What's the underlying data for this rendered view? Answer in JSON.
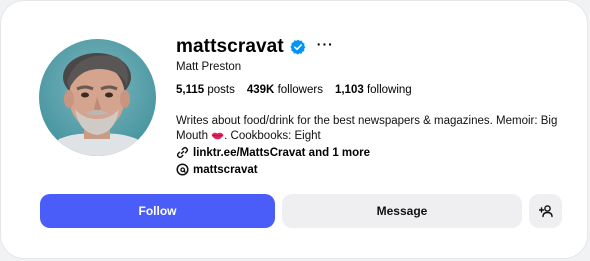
{
  "profile": {
    "username": "mattscravat",
    "full_name": "Matt Preston",
    "verified_icon": "verified-badge-icon",
    "more_icon": "more-options-icon",
    "more_glyph": "···",
    "stats": {
      "posts_count": "5,115",
      "posts_label": "posts",
      "followers_count": "439K",
      "followers_label": "followers",
      "following_count": "1,103",
      "following_label": "following"
    },
    "bio_line1": "Writes about food/drink for the best newspapers & magazines. Memoir: Big",
    "bio_line2_start": "Mouth",
    "bio_lips_emoji": "lips-emoji-icon",
    "bio_line2_end": ". Cookbooks: Eight",
    "link_text": "linktr.ee/MattsCravat and 1 more",
    "threads_handle": "mattscravat"
  },
  "actions": {
    "follow_label": "Follow",
    "message_label": "Message",
    "add_user_icon": "add-user-icon"
  },
  "colors": {
    "accent_button": "#4a5df9",
    "verified_badge": "#0095f6",
    "secondary_button": "#efeff1"
  }
}
